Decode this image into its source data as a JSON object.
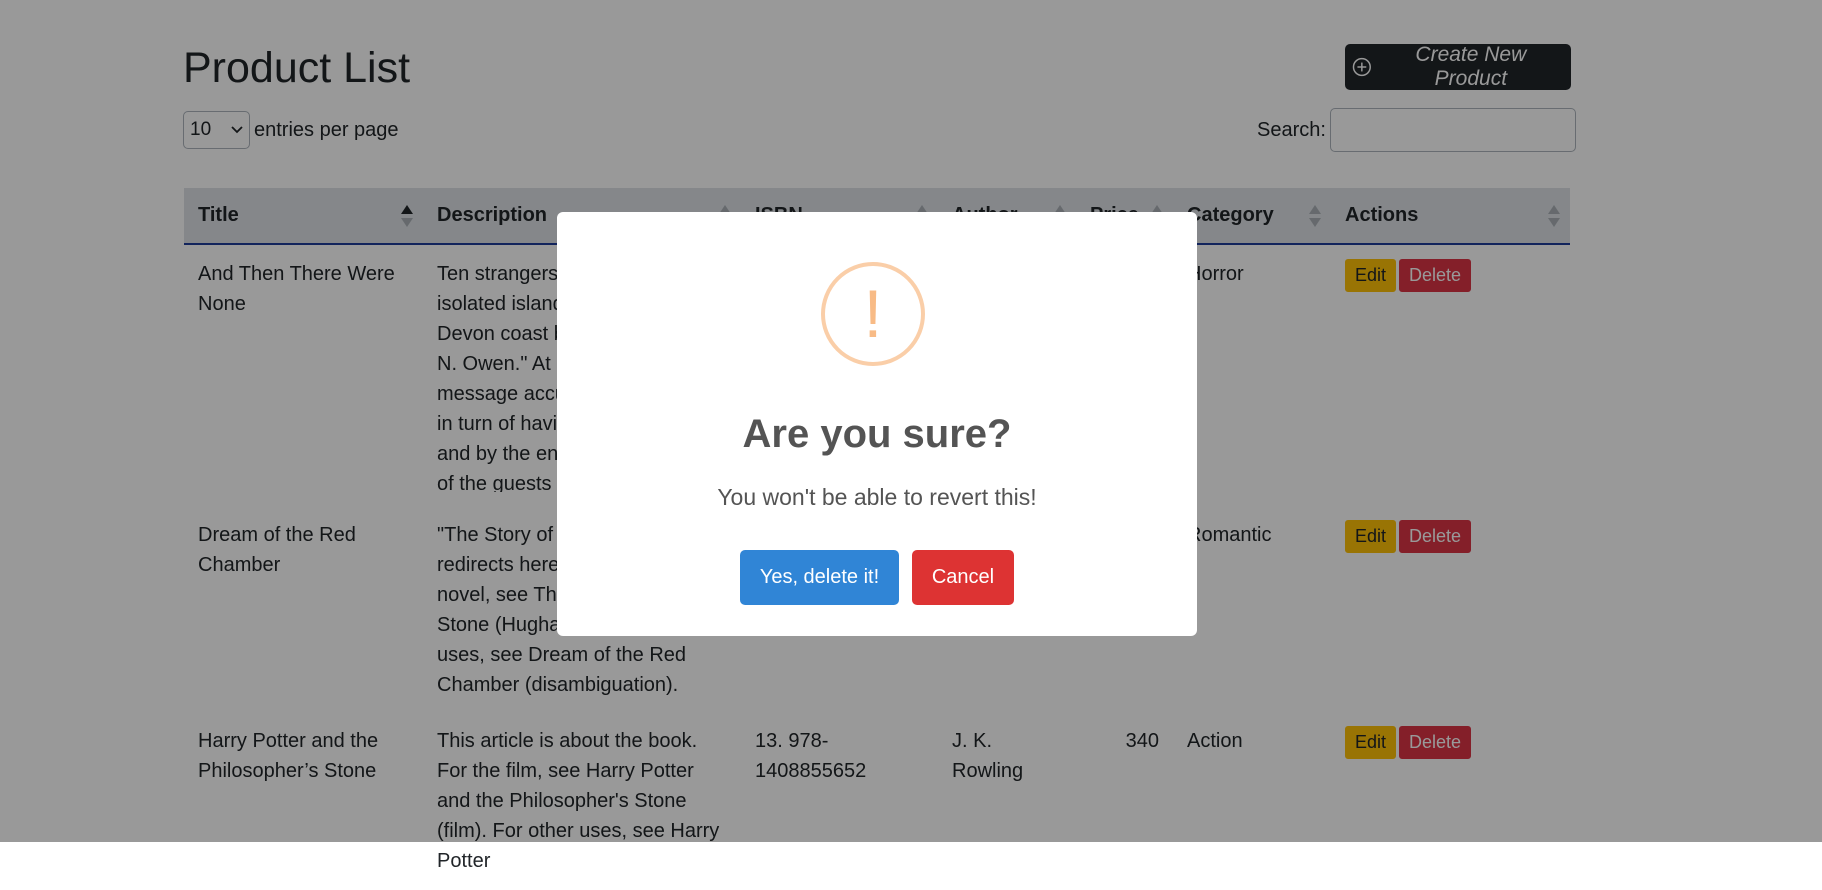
{
  "page": {
    "title": "Product List",
    "create_button": "Create New Product"
  },
  "controls": {
    "entries_value": "10",
    "entries_label": "entries per page",
    "search_label": "Search:"
  },
  "table": {
    "columns": [
      "Title",
      "Description",
      "ISBN",
      "Author",
      "Price",
      "Category",
      "Actions"
    ],
    "rows": [
      {
        "title": "And Then There Were None",
        "description": "Ten strangers are lured to an isolated island mansion off the Devon coast by a mysterious \"U. N. Owen.\" At dinner a recorded message accuses each of them in turn of having a guilty secret, and by the end of the night one of the guests is dead.",
        "isbn": "",
        "author": "",
        "price": "",
        "category": "Horror",
        "edit": "Edit",
        "delete": "Delete"
      },
      {
        "title": "Dream of the Red Chamber",
        "description": "\"The Story of the Stone\" redirects here. For the 1988 novel, see The Story of the Stone (Hughart novel). For other uses, see Dream of the Red Chamber (disambiguation).",
        "isbn": "",
        "author": "",
        "price": "",
        "category": "Romantic",
        "edit": "Edit",
        "delete": "Delete"
      },
      {
        "title": "Harry Potter and the Philosopher’s Stone",
        "description": "This article is about the book. For the film, see Harry Potter and the Philosopher's Stone (film). For other uses, see Harry Potter",
        "isbn": "13. 978-1408855652",
        "author": "J. K. Rowling",
        "price": "340",
        "category": "Action",
        "edit": "Edit",
        "delete": "Delete"
      }
    ]
  },
  "dialog": {
    "icon": "!",
    "title": "Are you sure?",
    "text": "You won't be able to revert this!",
    "confirm": "Yes, delete it!",
    "cancel": "Cancel"
  },
  "colors": {
    "confirm": "#3085d6",
    "cancel": "#dd3333",
    "warning": "#f8bb86",
    "edit": "#ffc107",
    "delete": "#dc3545",
    "dark": "#212529"
  }
}
